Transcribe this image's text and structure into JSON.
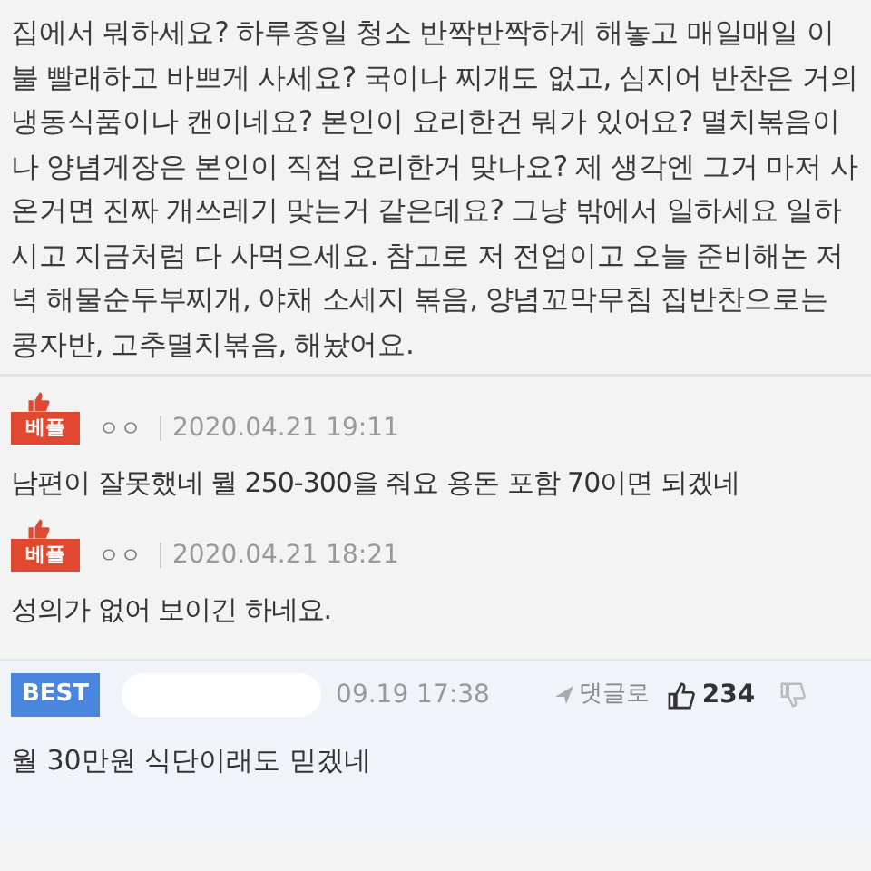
{
  "post": {
    "body": "집에서 뭐하세요? 하루종일 청소 반짝반짝하게 해놓고 매일매일 이불 빨래하고 바쁘게 사세요? 국이나 찌개도 없고, 심지어 반찬은 거의 냉동식품이나 캔이네요? 본인이 요리한건 뭐가 있어요? 멸치볶음이나 양념게장은 본인이 직접 요리한거 맞나요? 제 생각엔 그거 마저 사온거면 진짜 개쓰레기 맞는거 같은데요? 그냥 밖에서 일하세요 일하시고 지금처럼 다 사먹으세요. 참고로 저 전업이고 오늘 준비해논 저녁 해물순두부찌개, 야채 소세지 볶음, 양념꼬막무침 집반찬으로는 콩자반, 고추멸치볶음, 해놨어요."
  },
  "comments": [
    {
      "badge": "베플",
      "author": "ㅇㅇ",
      "date": "2020.04.21 19:11",
      "text": "남편이 잘못했네 뭘 250-300을 줘요 용돈 포함 70이면 되겠네"
    },
    {
      "badge": "베플",
      "author": "ㅇㅇ",
      "date": "2020.04.21 18:21",
      "text": "성의가 없어 보이긴 하네요."
    }
  ],
  "best_comment": {
    "badge": "BEST",
    "time": "09.19 17:38",
    "reply_label": "댓글로",
    "likes": "234",
    "text": "월 30만원 식단이래도 믿겠네"
  }
}
